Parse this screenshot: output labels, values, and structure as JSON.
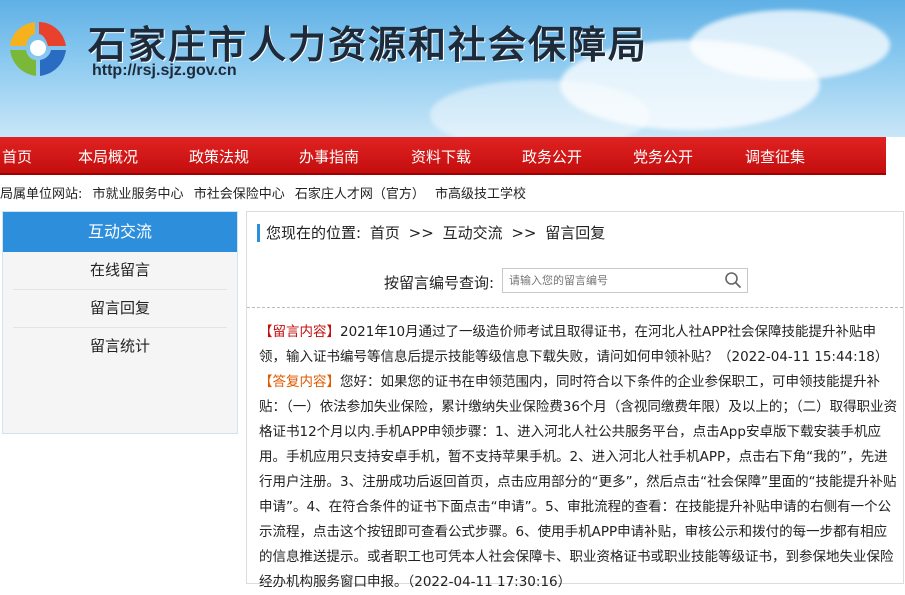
{
  "header": {
    "title": "石家庄市人力资源和社会保障局",
    "url": "http://rsj.sjz.gov.cn"
  },
  "nav": {
    "items": [
      "首页",
      "本局概况",
      "政策法规",
      "办事指南",
      "资料下载",
      "政务公开",
      "党务公开",
      "调查征集"
    ]
  },
  "units": {
    "label": "局属单位网站:",
    "links": [
      "市就业服务中心",
      "市社会保险中心",
      "石家庄人才网（官方）",
      "市高级技工学校"
    ]
  },
  "sidebar": {
    "title": "互动交流",
    "items": [
      "在线留言",
      "留言回复",
      "留言统计"
    ]
  },
  "breadcrumb": {
    "prefix": "您现在的位置:",
    "home": "首页",
    "sep1": ">>",
    "section": "互动交流",
    "sep2": ">>",
    "current": "留言回复"
  },
  "search": {
    "label": "按留言编号查询:",
    "placeholder": "请输入您的留言编号"
  },
  "message": {
    "tag": "【留言内容】",
    "text": "2021年10月通过了一级造价师考试且取得证书，在河北人社APP社会保障技能提升补贴申领，输入证书编号等信息后提示技能等级信息下载失败，请问如何申领补贴？（2022-04-11 15:44:18）"
  },
  "reply": {
    "tag": "【答复内容】",
    "text": "您好：如果您的证书在申领范围内，同时符合以下条件的企业参保职工，可申领技能提升补贴：（一）依法参加失业保险，累计缴纳失业保险费36个月（含视同缴费年限）及以上的；（二）取得职业资格证书12个月以内.手机APP申领步骤：1、进入河北人社公共服务平台，点击App安卓版下载安装手机应用。手机应用只支持安卓手机，暂不支持苹果手机。2、进入河北人社手机APP，点击右下角“我的”，先进行用户注册。3、注册成功后返回首页，点击应用部分的“更多”，然后点击“社会保障”里面的“技能提升补贴申请”。4、在符合条件的证书下面点击“申请”。5、审批流程的查看：在技能提升补贴申请的右侧有一个公示流程，点击这个按钮即可查看公式步骤。6、使用手机APP申请补贴，审核公示和拨付的每一步都有相应的信息推送提示。或者职工也可凭本人社会保障卡、职业资格证书或职业技能等级证书，到参保地失业保险经办机构服务窗口申报。（2022-04-11 17:30:16）"
  },
  "colors": {
    "nav_red": "#c40e0e",
    "sidebar_blue": "#2d8fdc",
    "reply_tag": "#e05a00"
  }
}
